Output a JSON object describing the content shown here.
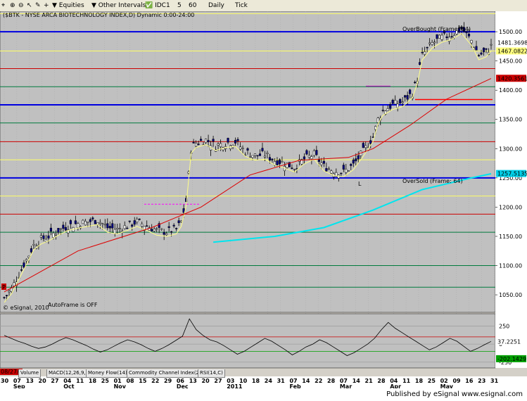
{
  "toolbar": {
    "equities": "Equities",
    "intervals": "Other Intervals",
    "idc": "IDC",
    "i1": "1",
    "i5": "5",
    "i60": "60",
    "daily": "Daily",
    "tick": "Tick"
  },
  "chart_title": "($BTK - NYSE ARCA BIOTECHNOLOGY INDEX,D) Dynamic 0:00-24:00",
  "overbought_label": "OverBought (Frame: 64)",
  "oversold_label": "OverSold (Frame: 64)",
  "autoframe_label": "AutoFrame is OFF",
  "copyright": "© eSignal, 2010",
  "marker_H": "H",
  "marker_L": "L",
  "marker_P": "P",
  "tabs": [
    "Volume",
    "MACD(12,26,9,C)",
    "Money Flow(14)",
    "Commodity Channel Index(23,C)",
    "RSI(14,C)"
  ],
  "footer": "Published by eSignal  www.esignal.com",
  "price_axis": {
    "ticks": [
      "1500.00",
      "1450.00",
      "1400.00",
      "1350.00",
      "1300.00",
      "1250.00",
      "1200.00",
      "1150.00",
      "1100.00",
      "1050.00"
    ],
    "ylim": [
      1020,
      1535
    ],
    "highlights": [
      {
        "text": "1481.3698",
        "bg": "#ffffff",
        "fg": "#000000",
        "value": 1481.3698
      },
      {
        "text": "1467.0822",
        "bg": "#ffff80",
        "fg": "#000000",
        "value": 1467.0822
      },
      {
        "text": "1420.35616",
        "bg": "#cc0000",
        "fg": "#ffffff",
        "value": 1420.35616
      },
      {
        "text": "1257.5135",
        "bg": "#00d0e8",
        "fg": "#ffffff",
        "value": 1257.5135
      }
    ]
  },
  "cci_axis": {
    "ticks": [
      "250",
      "0",
      "-250"
    ],
    "ylim": [
      -330,
      420
    ],
    "highlights": [
      {
        "text": "37.2251",
        "bg": "#ffffff",
        "fg": "#000000",
        "value": 37.2251
      },
      {
        "text": "-202.1429",
        "bg": "#00a000",
        "fg": "#ffffff",
        "value": -202.1429
      }
    ]
  },
  "x_axis": {
    "day_labels": [
      "30",
      "07",
      "13",
      "20",
      "27",
      "04",
      "11",
      "18",
      "25",
      "01",
      "08",
      "15",
      "22",
      "29",
      "06",
      "13",
      "20",
      "27",
      "03",
      "10",
      "18",
      "24",
      "31",
      "07",
      "14",
      "22",
      "28",
      "07",
      "14",
      "21",
      "28",
      "04",
      "11",
      "18",
      "25",
      "02",
      "09",
      "16",
      "23",
      "31"
    ],
    "month_labels": [
      "Sep",
      "Oct",
      "Nov",
      "Dec",
      "2011",
      "Feb",
      "Mar",
      "Apr",
      "May"
    ],
    "date_box": "08/27/10"
  },
  "colors": {
    "bg": "#c0c0c0",
    "blue_line": "#0000e0",
    "red_line": "#cc0000",
    "yellow_line": "#ffff66",
    "green_line": "#007a3d",
    "cyan_ma": "#00e5ee"
  },
  "chart_data": {
    "type": "candlestick",
    "title": "($BTK - NYSE ARCA BIOTECHNOLOGY INDEX,D) Dynamic 0:00-24:00",
    "x_start": "2010-08-27",
    "x_end": "2011-05-31",
    "ylim": [
      1020,
      1535
    ],
    "horizontal_levels": [
      {
        "value": 1531,
        "color": "yellow"
      },
      {
        "value": 1500,
        "color": "blue"
      },
      {
        "value": 1467,
        "color": "yellow"
      },
      {
        "value": 1437,
        "color": "red"
      },
      {
        "value": 1406,
        "color": "green"
      },
      {
        "value": 1375,
        "color": "blue"
      },
      {
        "value": 1344,
        "color": "green"
      },
      {
        "value": 1312,
        "color": "red"
      },
      {
        "value": 1281,
        "color": "yellow"
      },
      {
        "value": 1250,
        "color": "blue"
      },
      {
        "value": 1219,
        "color": "yellow"
      },
      {
        "value": 1188,
        "color": "red"
      },
      {
        "value": 1157,
        "color": "green"
      },
      {
        "value": 1100,
        "color": "green"
      },
      {
        "value": 1063,
        "color": "green"
      }
    ],
    "close_path": [
      [
        0,
        1045
      ],
      [
        3,
        1060
      ],
      [
        6,
        1085
      ],
      [
        9,
        1110
      ],
      [
        12,
        1135
      ],
      [
        15,
        1145
      ],
      [
        18,
        1150
      ],
      [
        22,
        1160
      ],
      [
        26,
        1168
      ],
      [
        30,
        1172
      ],
      [
        34,
        1175
      ],
      [
        38,
        1178
      ],
      [
        42,
        1165
      ],
      [
        46,
        1162
      ],
      [
        50,
        1168
      ],
      [
        54,
        1175
      ],
      [
        58,
        1168
      ],
      [
        62,
        1160
      ],
      [
        66,
        1158
      ],
      [
        70,
        1162
      ],
      [
        72,
        1175
      ],
      [
        74,
        1210
      ],
      [
        76,
        1300
      ],
      [
        78,
        1310
      ],
      [
        82,
        1315
      ],
      [
        86,
        1305
      ],
      [
        90,
        1310
      ],
      [
        94,
        1312
      ],
      [
        98,
        1295
      ],
      [
        102,
        1288
      ],
      [
        106,
        1290
      ],
      [
        110,
        1280
      ],
      [
        114,
        1275
      ],
      [
        118,
        1268
      ],
      [
        122,
        1282
      ],
      [
        126,
        1290
      ],
      [
        130,
        1270
      ],
      [
        134,
        1262
      ],
      [
        138,
        1260
      ],
      [
        142,
        1272
      ],
      [
        146,
        1295
      ],
      [
        150,
        1320
      ],
      [
        152,
        1350
      ],
      [
        154,
        1365
      ],
      [
        158,
        1375
      ],
      [
        162,
        1380
      ],
      [
        166,
        1395
      ],
      [
        168,
        1420
      ],
      [
        170,
        1460
      ],
      [
        174,
        1480
      ],
      [
        178,
        1490
      ],
      [
        182,
        1495
      ],
      [
        186,
        1505
      ],
      [
        190,
        1485
      ],
      [
        193,
        1460
      ],
      [
        196,
        1465
      ],
      [
        198,
        1475
      ]
    ],
    "ma_red": [
      [
        0,
        1055
      ],
      [
        30,
        1125
      ],
      [
        60,
        1165
      ],
      [
        80,
        1200
      ],
      [
        100,
        1255
      ],
      [
        120,
        1280
      ],
      [
        140,
        1285
      ],
      [
        150,
        1300
      ],
      [
        165,
        1340
      ],
      [
        180,
        1385
      ],
      [
        198,
        1420
      ]
    ],
    "ma_cyan": [
      [
        85,
        1140
      ],
      [
        110,
        1150
      ],
      [
        130,
        1165
      ],
      [
        150,
        1195
      ],
      [
        170,
        1230
      ],
      [
        190,
        1250
      ],
      [
        198,
        1257
      ]
    ],
    "cci_values": [
      120,
      80,
      40,
      10,
      -30,
      -60,
      -40,
      0,
      50,
      90,
      60,
      20,
      -20,
      -70,
      -110,
      -80,
      -30,
      20,
      60,
      30,
      -10,
      -60,
      -100,
      -60,
      -10,
      50,
      110,
      350,
      200,
      120,
      60,
      30,
      -20,
      -80,
      -140,
      -100,
      -40,
      20,
      80,
      40,
      -20,
      -80,
      -150,
      -100,
      -40,
      0,
      60,
      20,
      -40,
      -100,
      -160,
      -120,
      -60,
      0,
      80,
      200,
      300,
      220,
      160,
      100,
      40,
      -20,
      -80,
      -40,
      20,
      80,
      40,
      -30,
      -100,
      -60,
      -10,
      37
    ]
  }
}
